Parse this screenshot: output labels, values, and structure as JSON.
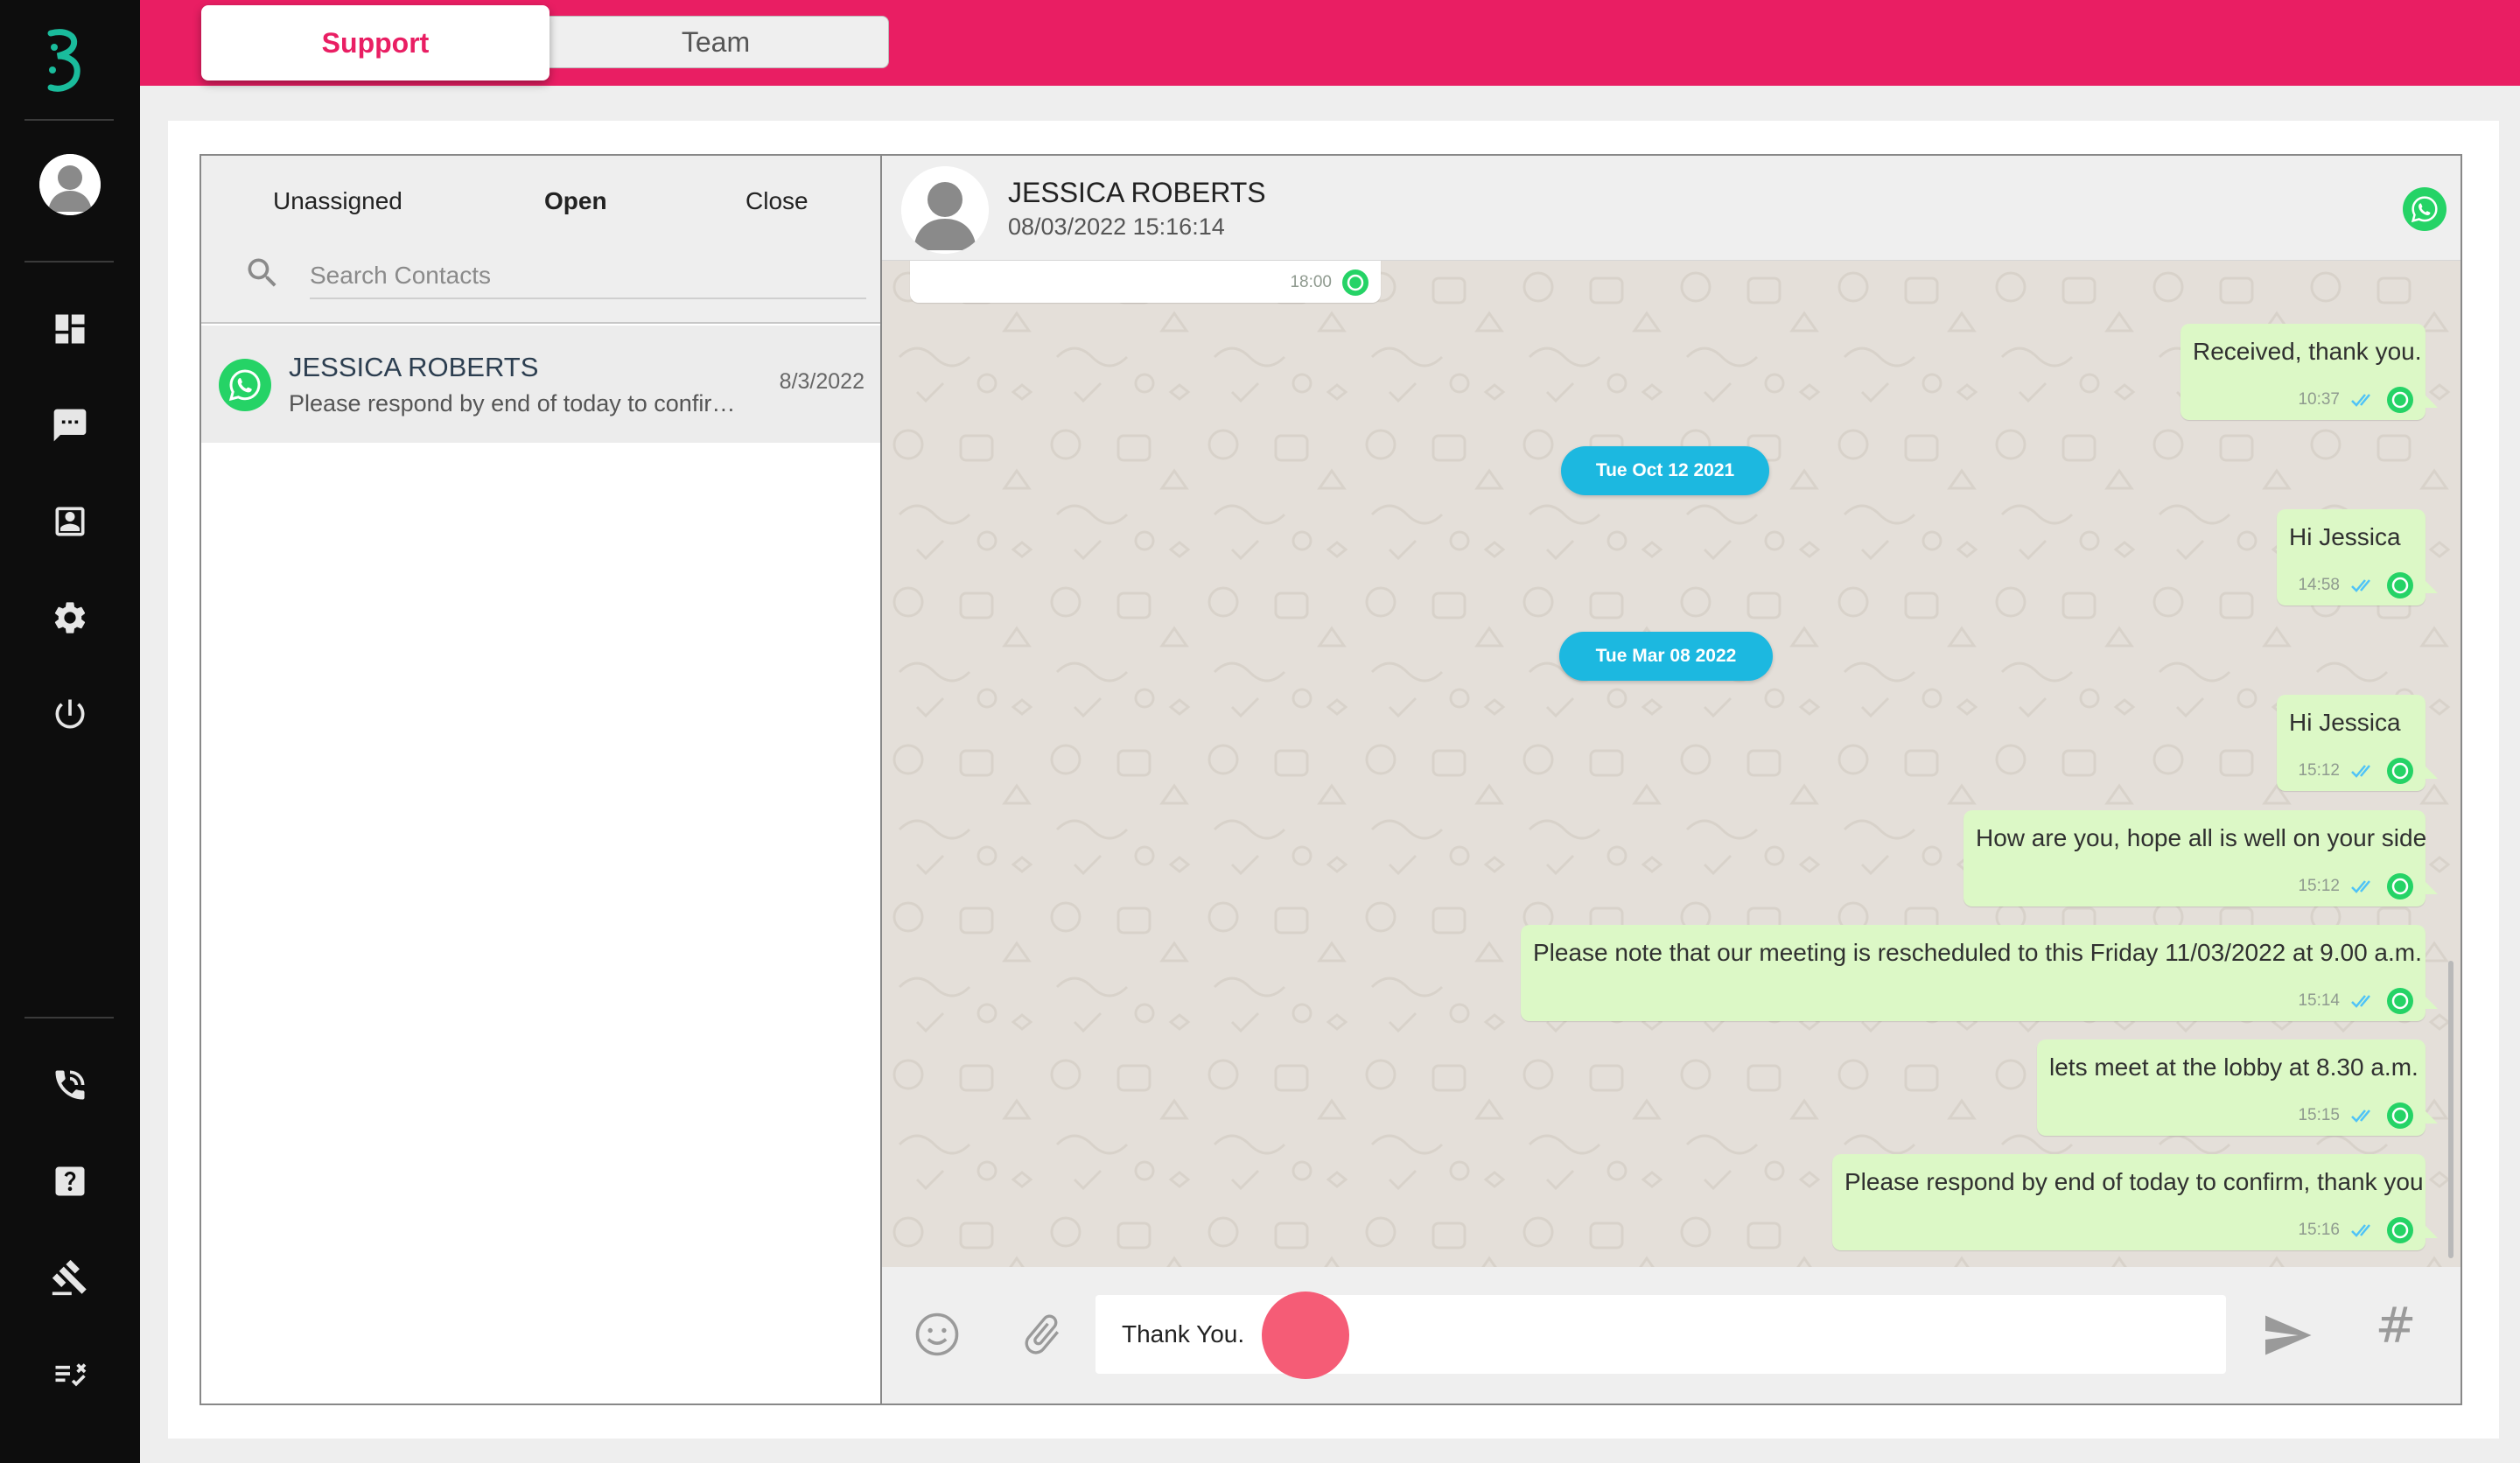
{
  "colors": {
    "brand": "#e91e63",
    "sidebar": "#0d0d0d",
    "whatsapp": "#25d366",
    "outgoing_bubble": "#dcf8c6",
    "date_pill": "#1cb8e0"
  },
  "sidebar": {
    "items": [
      {
        "name": "dashboard-icon"
      },
      {
        "name": "chat-icon"
      },
      {
        "name": "contacts-icon"
      },
      {
        "name": "settings-icon"
      },
      {
        "name": "power-icon"
      },
      {
        "name": "phone-icon"
      },
      {
        "name": "help-icon"
      },
      {
        "name": "gavel-icon"
      },
      {
        "name": "checklist-icon"
      }
    ]
  },
  "tabs": {
    "support": "Support",
    "team": "Team"
  },
  "contact_list": {
    "filters": {
      "unassigned": "Unassigned",
      "open": "Open",
      "close": "Close"
    },
    "search_placeholder": "Search Contacts",
    "contacts": [
      {
        "name": "JESSICA ROBERTS",
        "preview": "Please respond by end of today to confirm, thank you",
        "date": "8/3/2022"
      }
    ]
  },
  "chat": {
    "contact_name": "JESSICA ROBERTS",
    "contact_datetime": "08/03/2022 15:16:14",
    "messages": [
      {
        "type": "in",
        "text": "",
        "time": "18:00"
      },
      {
        "type": "out",
        "text": "Received, thank you.",
        "time": "10:37"
      },
      {
        "type": "date",
        "text": "Tue Oct 12 2021"
      },
      {
        "type": "out",
        "text": "Hi Jessica",
        "time": "14:58"
      },
      {
        "type": "date",
        "text": "Tue Mar 08 2022"
      },
      {
        "type": "out",
        "text": "Hi Jessica",
        "time": "15:12"
      },
      {
        "type": "out",
        "text": "How are you, hope all is well on your side",
        "time": "15:12"
      },
      {
        "type": "out",
        "text": "Please note that our meeting is rescheduled to this Friday 11/03/2022 at 9.00 a.m.",
        "time": "15:14"
      },
      {
        "type": "out",
        "text": "lets meet at the lobby at 8.30 a.m.",
        "time": "15:15"
      },
      {
        "type": "out",
        "text": "Please respond by end of today to confirm, thank you",
        "time": "15:16"
      }
    ],
    "composer_value": "Thank You.",
    "hash_label": "#"
  }
}
